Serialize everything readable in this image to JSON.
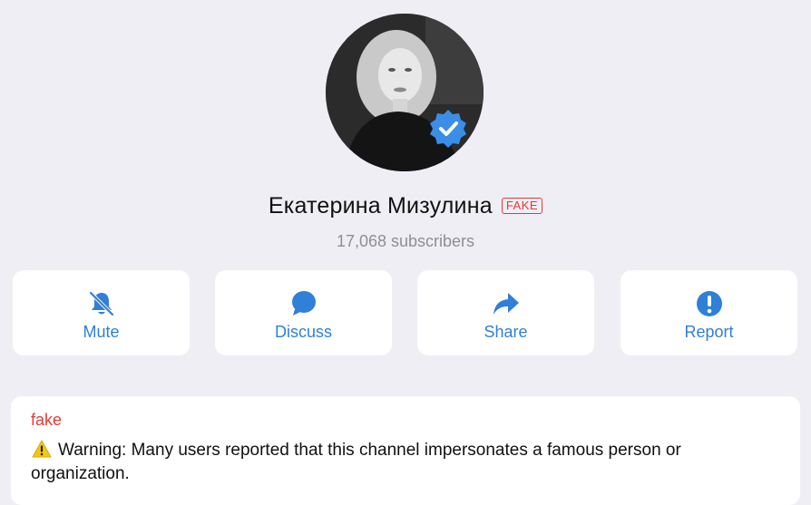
{
  "channel": {
    "name": "Екатерина Мизулина",
    "badge": "FAKE",
    "subscribers": "17,068 subscribers"
  },
  "actions": [
    {
      "label": "Mute",
      "icon": "bell-slash-icon"
    },
    {
      "label": "Discuss",
      "icon": "chat-bubble-icon"
    },
    {
      "label": "Share",
      "icon": "share-arrow-icon"
    },
    {
      "label": "Report",
      "icon": "exclamation-circle-icon"
    }
  ],
  "notice": {
    "title": "fake",
    "icon": "warning-icon",
    "text": "Warning: Many users reported that this channel impersonates a famous person or organization."
  },
  "colors": {
    "background": "#efeef4",
    "accent": "#2f80d6",
    "danger": "#e53935",
    "verified": "#3b8de6"
  }
}
